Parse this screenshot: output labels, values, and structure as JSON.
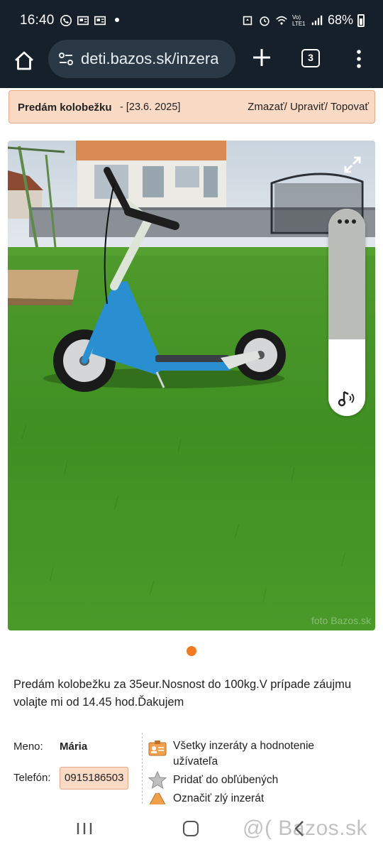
{
  "status_bar": {
    "time": "16:40",
    "lte_label": "Vo) LTE1",
    "battery": "68%"
  },
  "browser": {
    "url": "deti.bazos.sk/inzera",
    "tab_count": "3"
  },
  "ad": {
    "title": "Predám kolobežku",
    "date": " - [23.6. 2025]",
    "actions": "Zmazať/ Upraviť/ Topovať"
  },
  "photo": {
    "watermark": "foto Bazos.sk",
    "volume_level": 0.63
  },
  "description": "Predám kolobežku za 35eur.Nosnost do 100kg.V prípade záujmu volajte mi od 14.45 hod.Ďakujem",
  "contact": {
    "name_label": "Meno:",
    "name_value": "Mária",
    "phone_label": "Telefón:",
    "phone_value": "0915186503"
  },
  "links": {
    "user_ads": "Všetky inzeráty a hodnotenie užívateľa",
    "favorites": "Pridať do obľúbených",
    "report": "Označiť zlý inzerát"
  },
  "nav": {
    "watermark": "@( Bazos.sk"
  },
  "colors": {
    "accent": "#f47a20",
    "title_bg": "#fad9c5",
    "status_bg": "#16202a"
  }
}
